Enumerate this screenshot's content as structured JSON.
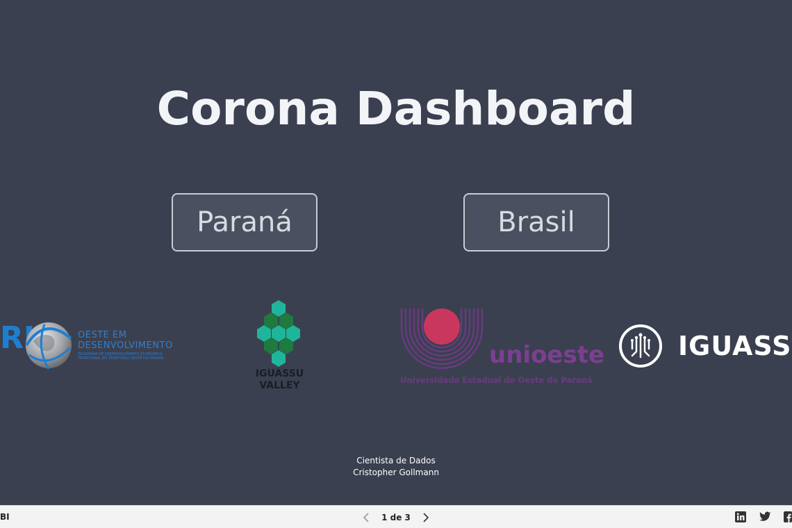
{
  "header": {
    "title": "Corona Dashboard"
  },
  "nav": {
    "parana_label": "Paraná",
    "brasil_label": "Brasil"
  },
  "logos": {
    "oeste": {
      "mark": "RI",
      "line1": "OESTE EM",
      "line2": "DESENVOLVIMENTO",
      "sub": "PROGRAMA DE DESENVOLVIMENTO ECONÔMICO TERRITORIAL DO TERRITÓRIO OESTE DO PARANÁ"
    },
    "valley": {
      "line1": "IGUASSU",
      "line2": "VALLEY"
    },
    "unioeste": {
      "name": "unioeste",
      "sub": "Universidade Estadual do Oeste do Paraná"
    },
    "iguassu": {
      "name": "IGUASSU"
    }
  },
  "credits": {
    "role": "Cientista de Dados",
    "author": "Cristopher Gollmann"
  },
  "footer": {
    "brand": "BI",
    "page_indicator": "1 de 3",
    "prev_icon": "chevron-left-icon",
    "next_icon": "chevron-right-icon",
    "share_icons": [
      "linkedin-icon",
      "twitter-icon",
      "facebook-icon"
    ]
  },
  "colors": {
    "background": "#3b4050",
    "button_fill": "#4b5060",
    "button_border": "#c9ccd4",
    "valley_green": "#1fb59a",
    "unioeste_purple": "#7b3f91",
    "unioeste_red": "#c9375e",
    "oeste_blue": "#1e7fd0"
  }
}
